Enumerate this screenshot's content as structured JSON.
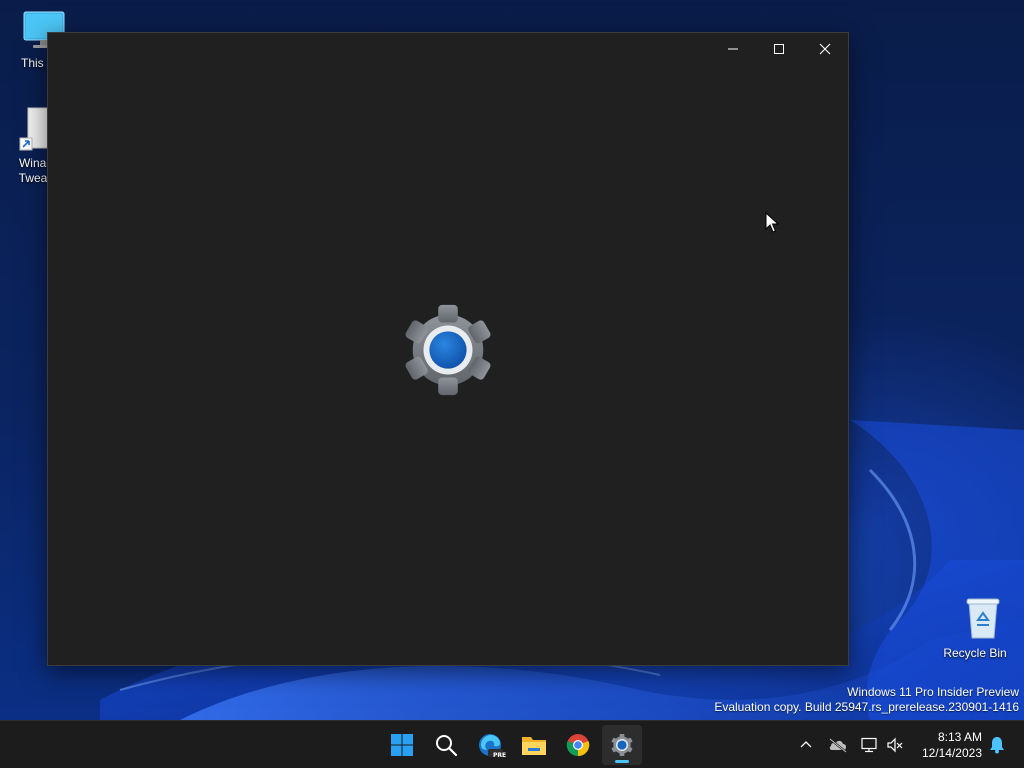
{
  "desktop": {
    "icons": [
      {
        "label": "This P"
      },
      {
        "label": "Winae\nTweak"
      },
      {
        "label": "Recycle Bin"
      }
    ],
    "watermark": {
      "line1": "Windows 11 Pro Insider Preview",
      "line2": "Evaluation copy. Build 25947.rs_prerelease.230901-1416"
    }
  },
  "window": {
    "app": "Settings",
    "splash_icon": "settings-gear-icon",
    "caption": {
      "minimize_icon": "minimize-icon",
      "maximize_icon": "maximize-icon",
      "close_icon": "close-icon"
    }
  },
  "taskbar": {
    "apps": [
      {
        "icon": "windows-start-icon"
      },
      {
        "icon": "search-icon"
      },
      {
        "icon": "edge-dev-icon",
        "badge": "PRE"
      },
      {
        "icon": "file-explorer-icon"
      },
      {
        "icon": "chrome-icon"
      },
      {
        "icon": "settings-gear-icon",
        "active": true
      }
    ],
    "tray": {
      "icons": [
        "chevron-up-icon",
        "onedrive-offline-icon",
        "network-icon",
        "volume-muted-icon",
        "notification-bell-icon"
      ],
      "time": "8:13 AM",
      "date": "12/14/2023"
    }
  },
  "colors": {
    "window_bg": "#202020",
    "taskbar_bg": "#1c1c1c",
    "accent": "#4cc2ff",
    "gear_blue": "#1565c0"
  }
}
